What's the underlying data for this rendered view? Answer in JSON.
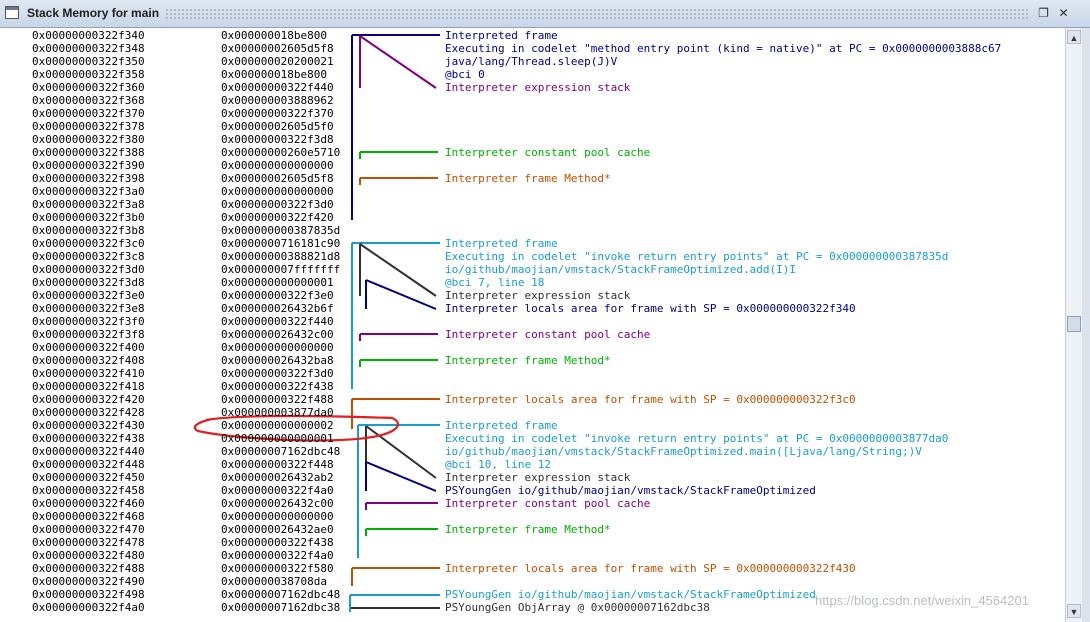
{
  "window": {
    "title": "Stack Memory for main",
    "restore_icon": "restore-icon",
    "close_icon": "close-icon"
  },
  "colors": {
    "navy": "#000080",
    "purple": "#800080",
    "green": "#00b000",
    "orange": "#c05000",
    "cyan": "#1a9ccf",
    "dark": "#303030",
    "ink_circle": "#e02020"
  },
  "rows": [
    {
      "addr": "0x00000000322f340",
      "val": "0x000000018be800"
    },
    {
      "addr": "0x00000000322f348",
      "val": "0x00000002605d5f8"
    },
    {
      "addr": "0x00000000322f350",
      "val": "0x000000020200021"
    },
    {
      "addr": "0x00000000322f358",
      "val": "0x000000018be800"
    },
    {
      "addr": "0x00000000322f360",
      "val": "0x00000000322f440"
    },
    {
      "addr": "0x00000000322f368",
      "val": "0x000000003888962"
    },
    {
      "addr": "0x00000000322f370",
      "val": "0x00000000322f370"
    },
    {
      "addr": "0x00000000322f378",
      "val": "0x00000002605d5f0"
    },
    {
      "addr": "0x00000000322f380",
      "val": "0x00000000322f3d8"
    },
    {
      "addr": "0x00000000322f388",
      "val": "0x00000000260e5710"
    },
    {
      "addr": "0x00000000322f390",
      "val": "0x000000000000000"
    },
    {
      "addr": "0x00000000322f398",
      "val": "0x00000002605d5f8"
    },
    {
      "addr": "0x00000000322f3a0",
      "val": "0x000000000000000"
    },
    {
      "addr": "0x00000000322f3a8",
      "val": "0x00000000322f3d0"
    },
    {
      "addr": "0x00000000322f3b0",
      "val": "0x00000000322f420"
    },
    {
      "addr": "0x00000000322f3b8",
      "val": "0x000000000387835d"
    },
    {
      "addr": "0x00000000322f3c0",
      "val": "0x0000000716181c90"
    },
    {
      "addr": "0x00000000322f3c8",
      "val": "0x00000000388821d8"
    },
    {
      "addr": "0x00000000322f3d0",
      "val": "0x000000007fffffff"
    },
    {
      "addr": "0x00000000322f3d8",
      "val": "0x000000000000001"
    },
    {
      "addr": "0x00000000322f3e0",
      "val": "0x00000000322f3e0"
    },
    {
      "addr": "0x00000000322f3e8",
      "val": "0x000000026432b6f"
    },
    {
      "addr": "0x00000000322f3f0",
      "val": "0x00000000322f440"
    },
    {
      "addr": "0x00000000322f3f8",
      "val": "0x000000026432c00"
    },
    {
      "addr": "0x00000000322f400",
      "val": "0x000000000000000"
    },
    {
      "addr": "0x00000000322f408",
      "val": "0x000000026432ba8"
    },
    {
      "addr": "0x00000000322f410",
      "val": "0x00000000322f3d0"
    },
    {
      "addr": "0x00000000322f418",
      "val": "0x00000000322f438"
    },
    {
      "addr": "0x00000000322f420",
      "val": "0x00000000322f488"
    },
    {
      "addr": "0x00000000322f428",
      "val": "0x000000003877da0"
    },
    {
      "addr": "0x00000000322f430",
      "val": "0x000000000000002"
    },
    {
      "addr": "0x00000000322f438",
      "val": "0x000000000000001"
    },
    {
      "addr": "0x00000000322f440",
      "val": "0x00000007162dbc48"
    },
    {
      "addr": "0x00000000322f448",
      "val": "0x00000000322f448"
    },
    {
      "addr": "0x00000000322f450",
      "val": "0x000000026432ab2"
    },
    {
      "addr": "0x00000000322f458",
      "val": "0x00000000322f4a0"
    },
    {
      "addr": "0x00000000322f460",
      "val": "0x000000026432c00"
    },
    {
      "addr": "0x00000000322f468",
      "val": "0x000000000000000"
    },
    {
      "addr": "0x00000000322f470",
      "val": "0x000000026432ae0"
    },
    {
      "addr": "0x00000000322f478",
      "val": "0x00000000322f438"
    },
    {
      "addr": "0x00000000322f480",
      "val": "0x00000000322f4a0"
    },
    {
      "addr": "0x00000000322f488",
      "val": "0x00000000322f580"
    },
    {
      "addr": "0x00000000322f490",
      "val": "0x000000038708da"
    },
    {
      "addr": "0x00000000322f498",
      "val": "0x00000007162dbc48"
    },
    {
      "addr": "0x00000000322f4a0",
      "val": "0x00000007162dbc38"
    }
  ],
  "annotations": [
    {
      "row": 0,
      "text": "Interpreted frame",
      "color": "navy"
    },
    {
      "row": 1,
      "text": "Executing in codelet \"method entry point (kind = native)\" at PC = 0x0000000003888c67",
      "color": "navy"
    },
    {
      "row": 2,
      "text": "java/lang/Thread.sleep(J)V",
      "color": "navy"
    },
    {
      "row": 3,
      "text": "@bci 0",
      "color": "navy"
    },
    {
      "row": 4,
      "text": "Interpreter expression stack",
      "color": "purple"
    },
    {
      "row": 9,
      "text": "Interpreter constant pool cache",
      "color": "green"
    },
    {
      "row": 11,
      "text": "Interpreter frame Method*",
      "color": "orange"
    },
    {
      "row": 16,
      "text": "Interpreted frame",
      "color": "cyan"
    },
    {
      "row": 17,
      "text": "Executing in codelet \"invoke return entry points\" at PC = 0x000000000387835d",
      "color": "cyan"
    },
    {
      "row": 18,
      "text": "io/github/maojian/vmstack/StackFrameOptimized.add(I)I",
      "color": "cyan"
    },
    {
      "row": 19,
      "text": "@bci 7, line 18",
      "color": "cyan"
    },
    {
      "row": 20,
      "text": "Interpreter expression stack",
      "color": "dark"
    },
    {
      "row": 21,
      "text": "Interpreter locals area for frame with SP = 0x000000000322f340",
      "color": "navy"
    },
    {
      "row": 23,
      "text": "Interpreter constant pool cache",
      "color": "purple"
    },
    {
      "row": 25,
      "text": "Interpreter frame Method*",
      "color": "green"
    },
    {
      "row": 28,
      "text": "Interpreter locals area for frame with SP = 0x000000000322f3c0",
      "color": "orange"
    },
    {
      "row": 30,
      "text": "Interpreted frame",
      "color": "cyan"
    },
    {
      "row": 31,
      "text": "Executing in codelet \"invoke return entry points\" at PC = 0x0000000003877da0",
      "color": "cyan"
    },
    {
      "row": 32,
      "text": "io/github/maojian/vmstack/StackFrameOptimized.main([Ljava/lang/String;)V",
      "color": "cyan"
    },
    {
      "row": 33,
      "text": "@bci 10, line 12",
      "color": "cyan"
    },
    {
      "row": 34,
      "text": "Interpreter expression stack",
      "color": "dark"
    },
    {
      "row": 35,
      "text": "PSYoungGen io/github/maojian/vmstack/StackFrameOptimized",
      "color": "navy"
    },
    {
      "row": 36,
      "text": "Interpreter constant pool cache",
      "color": "purple"
    },
    {
      "row": 38,
      "text": "Interpreter frame Method*",
      "color": "green"
    },
    {
      "row": 41,
      "text": "Interpreter locals area for frame with SP = 0x000000000322f430",
      "color": "orange"
    },
    {
      "row": 43,
      "text": "PSYoungGen io/github/maojian/vmstack/StackFrameOptimized",
      "color": "cyan"
    },
    {
      "row": 44,
      "text": "PSYoungGen ObjArray @ 0x00000007162dbc38",
      "color": "dark"
    }
  ],
  "watermark": "https://blog.csdn.net/weixin_4564201"
}
